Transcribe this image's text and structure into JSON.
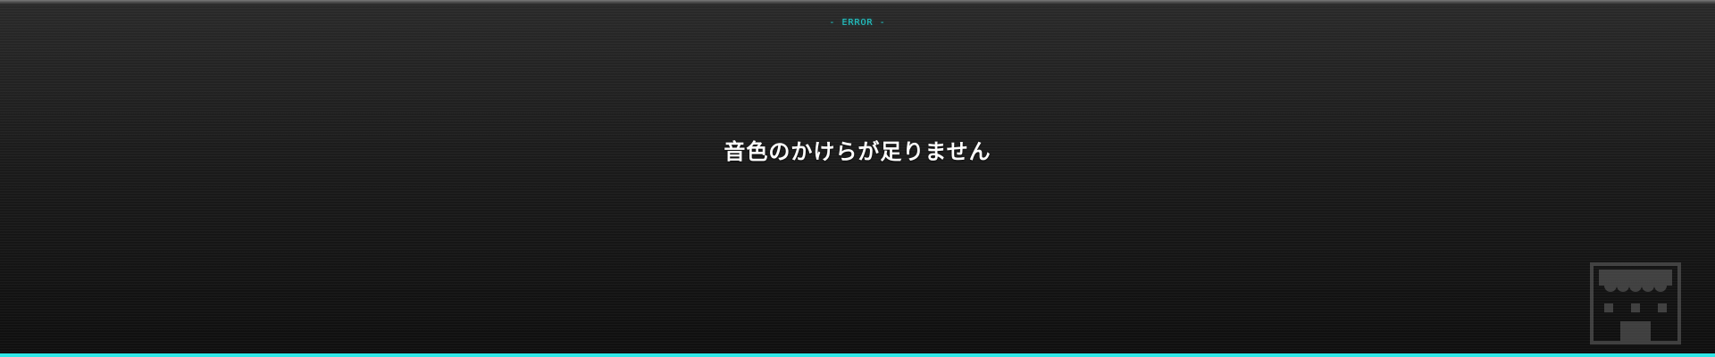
{
  "header": {
    "error_label": "- ERROR -"
  },
  "main": {
    "message": "音色のかけらが足りません"
  },
  "icons": {
    "corner_icon": "shop-icon"
  },
  "colors": {
    "accent": "#2fe7e7",
    "error_label": "#22d6d6",
    "text": "#ffffff",
    "background": "#151515"
  }
}
